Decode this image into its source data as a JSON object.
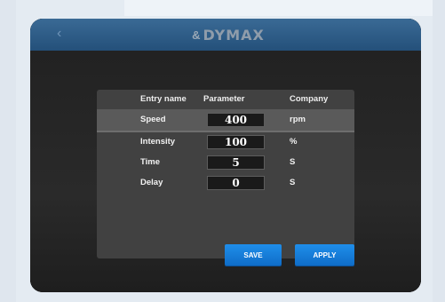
{
  "header": {
    "back_icon": "chevron-left",
    "logo_mark": "&",
    "logo_text": "DYMAX"
  },
  "table": {
    "columns": [
      "Entry name",
      "Parameter",
      "Company"
    ],
    "rows": [
      {
        "name": "Speed",
        "value": "400",
        "unit": "rpm"
      },
      {
        "name": "Intensity",
        "value": "100",
        "unit": "%"
      },
      {
        "name": "Time",
        "value": "5",
        "unit": "S"
      },
      {
        "name": "Delay",
        "value": "0",
        "unit": "S"
      }
    ]
  },
  "buttons": {
    "save": "SAVE",
    "apply": "APPLY"
  },
  "colors": {
    "header": "#2a5a86",
    "button": "#1a80dd",
    "panel": "#414141"
  }
}
